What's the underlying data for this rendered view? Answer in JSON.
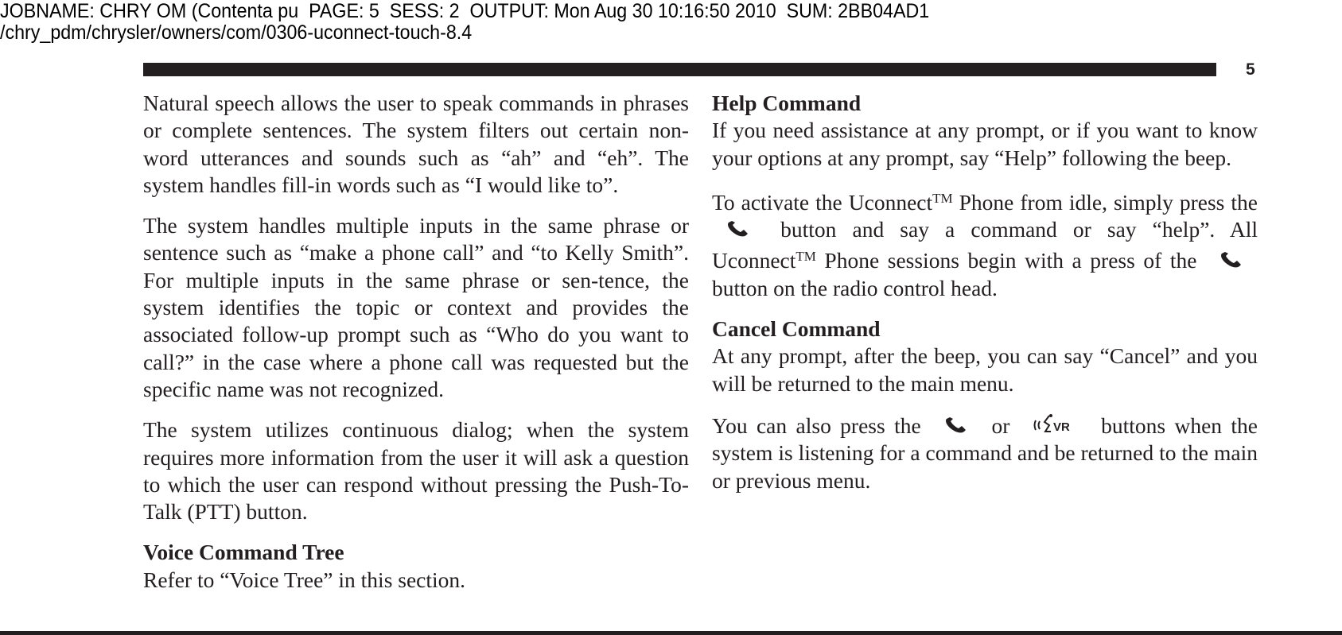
{
  "print_header": {
    "jobline": "JOBNAME: CHRY OM (Contenta pu  PAGE: 5  SESS: 2  OUTPUT: Mon Aug 30 10:16:50 2010  SUM: 2BB04AD1",
    "path": "/chry_pdm/chrysler/owners/com/0306-uconnect-touch-8.4"
  },
  "page_number": "5",
  "left_column": {
    "p1": "Natural speech allows the user to speak commands in phrases or complete sentences. The system filters out certain non-word utterances and sounds such as “ah” and “eh”. The system handles fill-in words such as “I would like to”.",
    "p2": "The system handles multiple inputs in the same phrase or sentence such as “make a phone call” and “to Kelly Smith”. For multiple inputs in the same phrase or sen-tence, the system identifies the topic or context and provides the associated follow-up prompt such as “Who do you want to call?” in the case where a phone call was requested but the specific name was not recognized.",
    "p3": "The system utilizes continuous dialog; when the system requires more information from the user it will ask a question to which the user can respond without pressing the Push-To-Talk (PTT) button.",
    "heading_voice_tree": "Voice Command Tree",
    "p4": "Refer to “Voice Tree” in this section."
  },
  "right_column": {
    "heading_help": "Help Command",
    "help_text": "If you need assistance at any prompt, or if you want to know your options at any prompt, say “Help” following the beep.",
    "activate": {
      "part1": "To activate the Uconnect",
      "tm": "TM",
      "part2": " Phone from idle, simply press the",
      "part3": "button and say a command or say “help”. All Uconnect",
      "part4": " Phone sessions begin with a press of the",
      "part5": "button on the radio control head."
    },
    "heading_cancel": "Cancel Command",
    "cancel_text": "At any prompt, after the beep, you can say “Cancel” and you will be returned to the main menu.",
    "also": {
      "part1": "You can also press the",
      "or": "or",
      "part2": "buttons when the system is listening for a command and be returned to the main or previous menu."
    },
    "icons": {
      "phone": "phone-icon",
      "voice": "voice-recognition-icon",
      "voice_label": "VR"
    }
  }
}
